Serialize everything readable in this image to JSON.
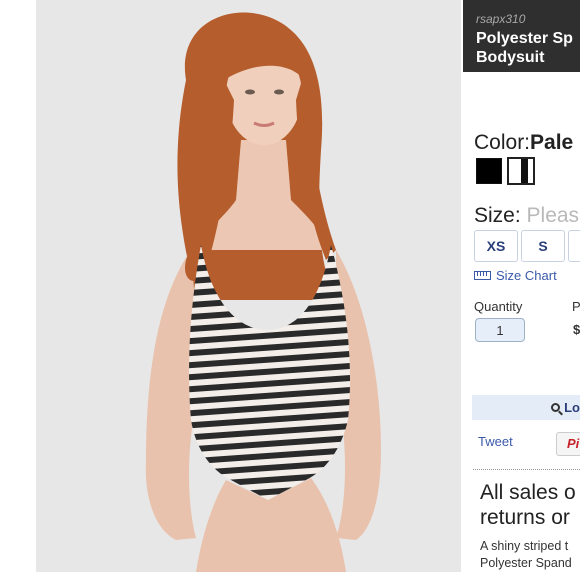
{
  "product": {
    "sku": "rsapx310",
    "title_line1": "Polyester Sp",
    "title_line2": "Bodysuit",
    "photo_description": "Model wearing a black and white striped bodysuit"
  },
  "color": {
    "label": "Color:",
    "selected": "Pale",
    "swatches": [
      {
        "name": "black",
        "color": "#000000"
      },
      {
        "name": "white-black-stripe",
        "color": "#ffffff"
      }
    ]
  },
  "size": {
    "label": "Size:",
    "placeholder": "Pleas",
    "options": [
      "XS",
      "S"
    ],
    "chart_link": "Size Chart"
  },
  "quantity": {
    "label": "Quantity",
    "value": "1"
  },
  "price": {
    "label": "P",
    "value": "$"
  },
  "lookup_button": "Lo",
  "social": {
    "tweet": "Tweet",
    "pin": "Pi"
  },
  "notice": {
    "line1": "All sales o",
    "line2": "returns or"
  },
  "description": {
    "line1": "A shiny striped t",
    "line2": "Polyester Spand"
  },
  "colors": {
    "header_bg": "#2f2f2f",
    "link": "#3a5aa8",
    "accent_button_bg": "#e4ecf8"
  }
}
